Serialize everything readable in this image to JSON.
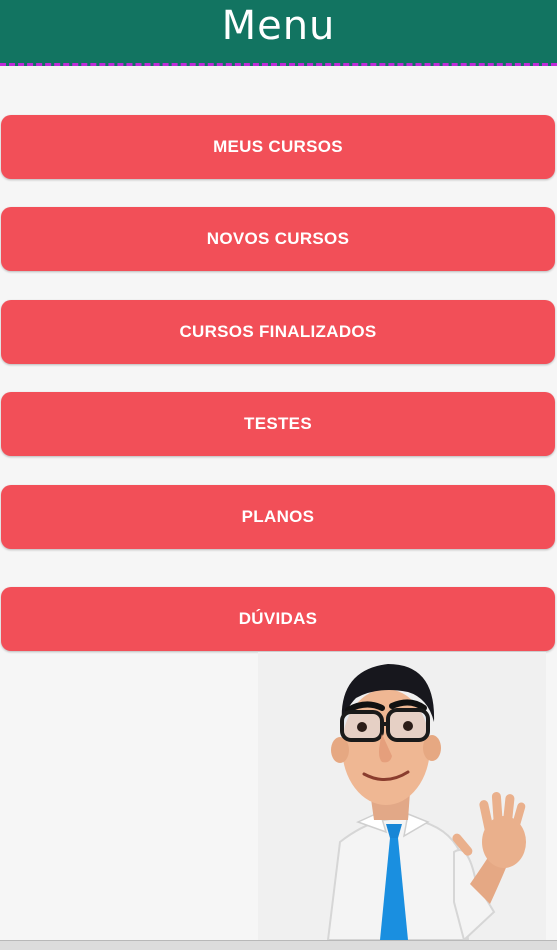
{
  "header": {
    "title": "Menu",
    "color": "#127461",
    "divider_color": "#c02bd8"
  },
  "menu": {
    "items": [
      {
        "label": "MEUS CURSOS"
      },
      {
        "label": "NOVOS CURSOS"
      },
      {
        "label": "CURSOS FINALIZADOS"
      },
      {
        "label": "TESTES"
      },
      {
        "label": "PLANOS"
      },
      {
        "label": "DÚVIDAS"
      }
    ],
    "button_color": "#f24f58"
  },
  "mascot": {
    "icon": "waving-cartoon-man"
  }
}
